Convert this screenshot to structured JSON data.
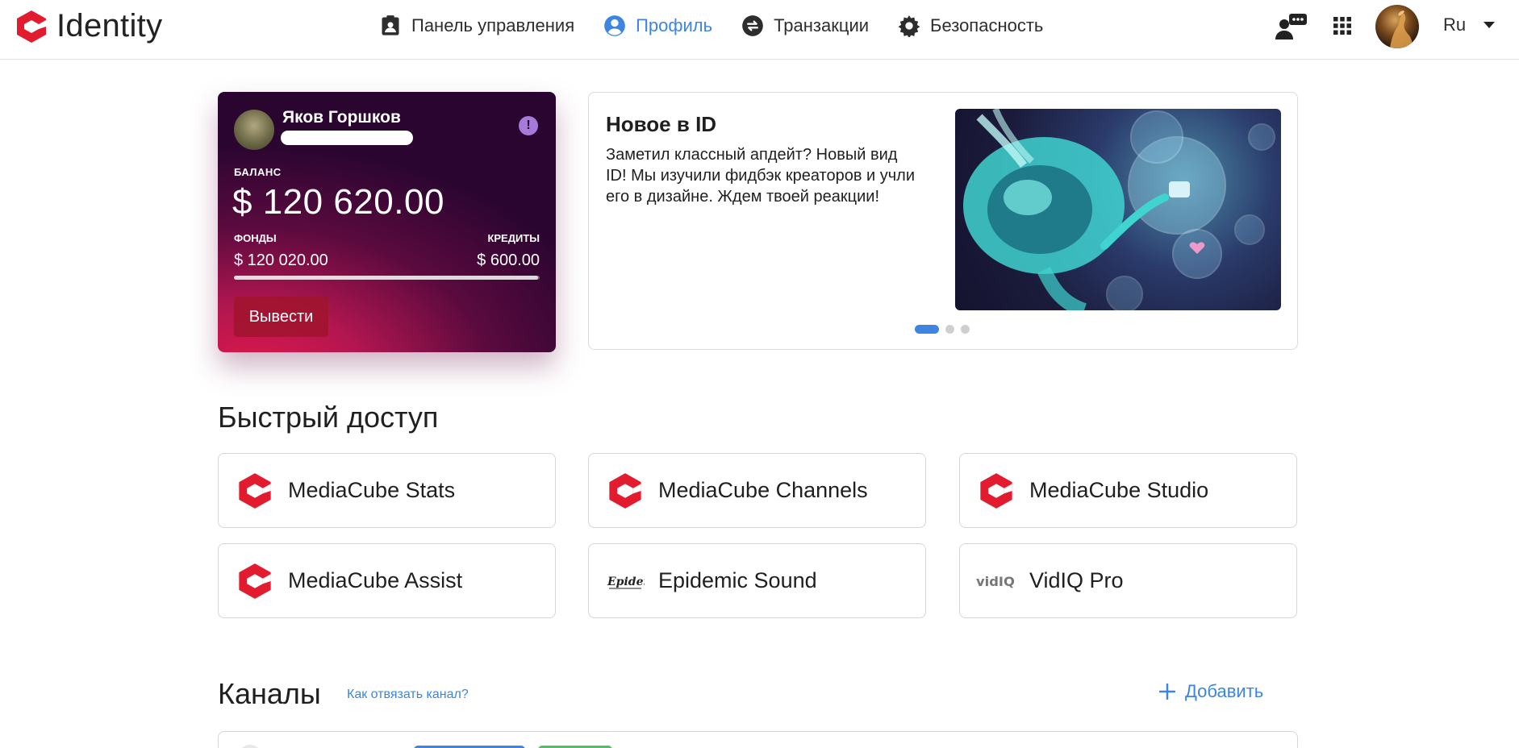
{
  "header": {
    "logo_text": "Identity",
    "nav": [
      {
        "label": "Панель управления",
        "icon": "clipboard-user-icon",
        "active": false
      },
      {
        "label": "Профиль",
        "icon": "user-circle-icon",
        "active": true
      },
      {
        "label": "Транзакции",
        "icon": "swap-arrows-icon",
        "active": false
      },
      {
        "label": "Безопасность",
        "icon": "gear-icon",
        "active": false
      }
    ],
    "language": "Ru",
    "accent_color": "#3d85e0",
    "brand_color": "#e31b2f"
  },
  "balance_card": {
    "user_name": "Яков Горшков",
    "balance_label": "БАЛАНС",
    "balance_value": "$ 120 620.00",
    "funds_label": "ФОНДЫ",
    "funds_value": "$ 120 020.00",
    "credits_label": "КРЕДИТЫ",
    "credits_value": "$ 600.00",
    "funds_share": 0.995,
    "withdraw_label": "Вывести",
    "alert_symbol": "!"
  },
  "news": {
    "title": "Новое в ID",
    "text": "Заметил классный апдейт? Новый вид ID! Мы изучили фидбэк креаторов и учли его в дизайне. Ждем твоей реакции!",
    "slides": 3,
    "active_slide": 0
  },
  "quick_access": {
    "title": "Быстрый доступ",
    "items": [
      {
        "label": "MediaCube Stats",
        "icon": "mediacube-logo-icon"
      },
      {
        "label": "MediaCube Channels",
        "icon": "mediacube-logo-icon"
      },
      {
        "label": "MediaCube Studio",
        "icon": "mediacube-logo-icon"
      },
      {
        "label": "MediaCube Assist",
        "icon": "mediacube-logo-icon"
      },
      {
        "label": "Epidemic Sound",
        "icon": "epidemic-logo-icon"
      },
      {
        "label": "VidIQ Pro",
        "icon": "vidiq-logo-icon"
      }
    ]
  },
  "channels": {
    "title": "Каналы",
    "help_link": "Как отвязать канал?",
    "add_label": "Добавить"
  }
}
